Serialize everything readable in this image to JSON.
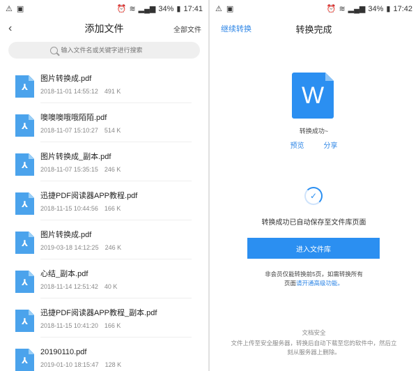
{
  "left": {
    "status": {
      "time": "17:41",
      "battery": "34%"
    },
    "title": "添加文件",
    "all_files": "全部文件",
    "search_placeholder": "输入文件名或关键字进行搜索",
    "files": [
      {
        "name": "图片转换成.pdf",
        "date": "2018-11-01 14:55:12",
        "size": "491 K"
      },
      {
        "name": "噢噢噢哦哦陌陌.pdf",
        "date": "2018-11-07 15:10:27",
        "size": "514 K"
      },
      {
        "name": "图片转换成_副本.pdf",
        "date": "2018-11-07 15:35:15",
        "size": "246 K"
      },
      {
        "name": "迅捷PDF阅读器APP教程.pdf",
        "date": "2018-11-15 10:44:56",
        "size": "166 K"
      },
      {
        "name": "图片转换成.pdf",
        "date": "2019-03-18 14:12:25",
        "size": "246 K"
      },
      {
        "name": "心结_副本.pdf",
        "date": "2018-11-14 12:51:42",
        "size": "40 K"
      },
      {
        "name": "迅捷PDF阅读器APP教程_副本.pdf",
        "date": "2018-11-15 10:41:20",
        "size": "166 K"
      },
      {
        "name": "20190110.pdf",
        "date": "2019-01-10 18:15:47",
        "size": "128 K"
      }
    ]
  },
  "right": {
    "status": {
      "time": "17:42",
      "battery": "34%"
    },
    "continue": "继续转换",
    "title": "转换完成",
    "doc_letter": "W",
    "success_small": "转换成功~",
    "preview": "预览",
    "share": "分享",
    "saved_msg": "转换成功已自动保存至文件库页面",
    "enter_button": "进入文件库",
    "member_note_1": "非会员仅能转换前5页，如需转换所有",
    "member_note_2": "页面",
    "member_note_link": "请开通高级功能。",
    "security_title": "文档安全",
    "security_text": "文件上传至安全服务器，转换后自动下载至您的软件中，然后立刻从服务器上删除。"
  },
  "colors": {
    "accent": "#2b8ff1",
    "pdf": "#4ba3ec"
  }
}
